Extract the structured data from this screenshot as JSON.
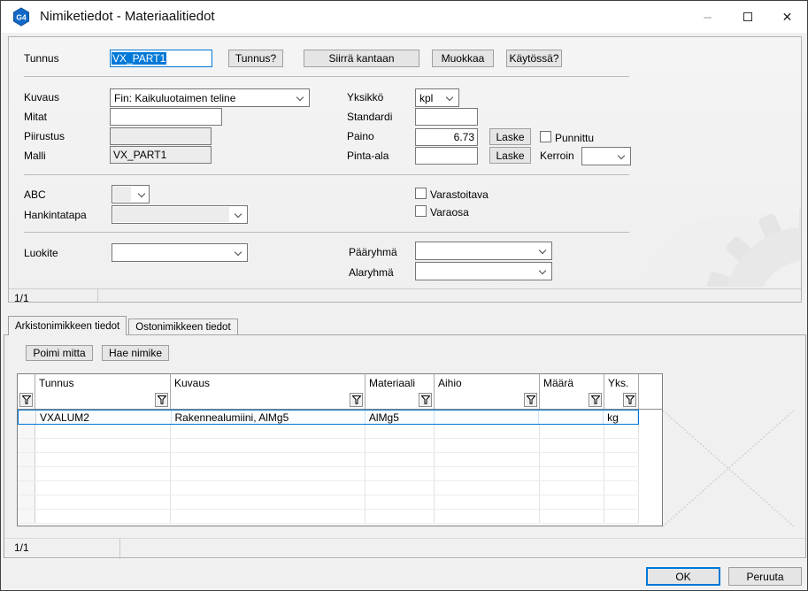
{
  "colors": {
    "accent": "#0078d7",
    "titlebar_bg": "#ffffff",
    "dialog_bg": "#f0f0f0",
    "app_icon_blue": "#1269c7"
  },
  "window": {
    "title": "Nimiketiedot - Materiaalitiedot",
    "icon_text": "G4",
    "controls": {
      "minimize": "–",
      "close": "✕"
    }
  },
  "form": {
    "tunnus_label": "Tunnus",
    "tunnus_value": "VX_PART1",
    "btn_tunnus": "Tunnus?",
    "btn_siirra": "Siirrä kantaan",
    "btn_muokkaa": "Muokkaa",
    "btn_kaytossa": "Käytössä?",
    "kuvaus_label": "Kuvaus",
    "kuvaus_value": "Fin: Kaikuluotaimen teline",
    "mitat_label": "Mitat",
    "mitat_value": "",
    "piirustus_label": "Piirustus",
    "piirustus_value": "",
    "malli_label": "Malli",
    "malli_value": "VX_PART1",
    "yksikko_label": "Yksikkö",
    "yksikko_value": "kpl",
    "standardi_label": "Standardi",
    "standardi_value": "",
    "paino_label": "Paino",
    "paino_value": "6.73",
    "laske_label": "Laske",
    "punnittu_label": "Punnittu",
    "pinta_ala_label": "Pinta-ala",
    "pinta_ala_value": "",
    "kerroin_label": "Kerroin",
    "kerroin_value": "",
    "abc_label": "ABC",
    "abc_value": "",
    "hankintatapa_label": "Hankintatapa",
    "hankintatapa_value": "",
    "varastoitava_label": "Varastoitava",
    "varaosa_label": "Varaosa",
    "luokite_label": "Luokite",
    "luokite_value": "",
    "paaryhma_label": "Pääryhmä",
    "paaryhma_value": "",
    "alaryhma_label": "Alaryhmä",
    "alaryhma_value": "",
    "pager": "1/1"
  },
  "tabs": {
    "archive": "Arkistonimikkeen tiedot",
    "purchase": "Ostonimikkeen tiedot"
  },
  "tabpage": {
    "btn_poimi_mitta": "Poimi mitta",
    "btn_hae_nimike": "Hae nimike",
    "pager": "1/1"
  },
  "table": {
    "columns": [
      "Tunnus",
      "Kuvaus",
      "Materiaali",
      "Aihio",
      "Määrä",
      "Yks."
    ],
    "rows": [
      [
        "VXALUM2",
        "Rakennealumiini, AlMg5",
        "AlMg5",
        "",
        "",
        "kg"
      ]
    ]
  },
  "footer": {
    "ok": "OK",
    "cancel": "Peruuta"
  }
}
